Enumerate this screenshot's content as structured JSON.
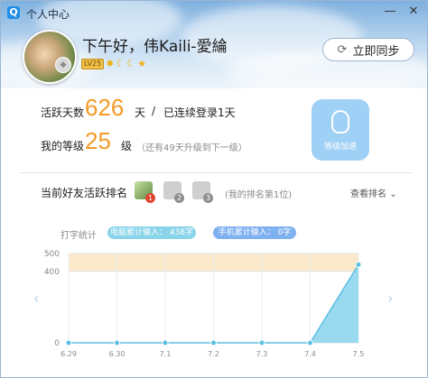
{
  "window": {
    "app_icon": "Q",
    "title": "个人中心",
    "controls": [
      "—",
      "✕"
    ]
  },
  "profile": {
    "greeting": "下午好，伟Kaili-愛綸",
    "level_badge": "LV25",
    "level_icons": [
      "sun-icon",
      "moon-icon",
      "moon-icon",
      "star-icon"
    ],
    "sync_label": "立即同步"
  },
  "stats": {
    "active_days_label": "活跃天数",
    "active_days": "626",
    "active_days_unit": "天",
    "separator": "/",
    "streak": "已连续登录1天",
    "level_label": "我的等级",
    "level": "25",
    "level_unit": "级",
    "level_hint": "（还有49天升级到下一级）",
    "accel_label": "等级加速"
  },
  "friends": {
    "title": "当前好友活跃排名",
    "ranks": [
      "1",
      "2",
      "3"
    ],
    "my_rank": "(我的排名第1位)",
    "view_rank": "查看排名"
  },
  "typing": {
    "label": "打字统计",
    "pc_input": "电脑累计输入： 438字",
    "mobile_input": "手机累计输入： 0字"
  },
  "colors": {
    "accent": "#f39b25",
    "chart_fill": "#87d3ef",
    "band": "#fbe9cc",
    "accel": "#9fd0f5"
  },
  "chart_data": {
    "type": "area",
    "categories": [
      "6.29",
      "6.30",
      "7.1",
      "7.2",
      "7.3",
      "7.4",
      "7.5"
    ],
    "values": [
      0,
      0,
      0,
      0,
      0,
      0,
      438
    ],
    "yticks": [
      "500",
      "400",
      "0"
    ],
    "ylim": [
      0,
      500
    ],
    "band": [
      400,
      500
    ],
    "grid": true
  }
}
